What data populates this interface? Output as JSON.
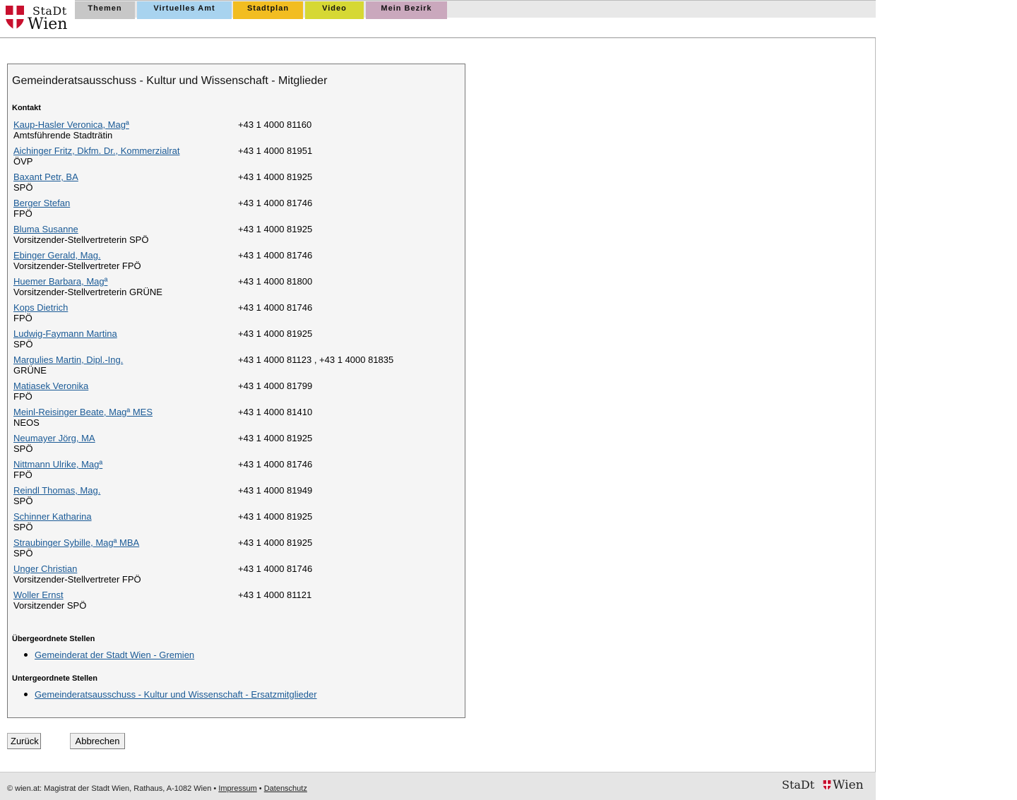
{
  "header": {
    "logo_line1": "StaDt",
    "logo_line2": "Wien",
    "nav": [
      {
        "label": "Themen",
        "color": "#c7c7c7"
      },
      {
        "label": "Virtuelles Amt",
        "color": "#a8d3ef"
      },
      {
        "label": "Stadtplan",
        "color": "#f2bd21"
      },
      {
        "label": "Video",
        "color": "#d6d834"
      },
      {
        "label": "Mein Bezirk",
        "color": "#caa8bd"
      }
    ]
  },
  "main": {
    "title": "Gemeinderatsausschuss - Kultur und Wissenschaft - Mitglieder",
    "contact_heading": "Kontakt",
    "members": [
      {
        "name": "Kaup-Hasler Veronica, Magª",
        "role": "Amtsführende Stadträtin",
        "phone": "+43 1 4000 81160"
      },
      {
        "name": "Aichinger Fritz, Dkfm. Dr., Kommerzialrat",
        "role": "ÖVP",
        "phone": "+43 1 4000 81951"
      },
      {
        "name": "Baxant Petr, BA",
        "role": "SPÖ",
        "phone": "+43 1 4000 81925"
      },
      {
        "name": "Berger Stefan",
        "role": "FPÖ",
        "phone": "+43 1 4000 81746"
      },
      {
        "name": "Bluma Susanne",
        "role": "Vorsitzender-Stellvertreterin SPÖ",
        "phone": "+43 1 4000 81925"
      },
      {
        "name": "Ebinger Gerald, Mag.",
        "role": "Vorsitzender-Stellvertreter FPÖ",
        "phone": "+43 1 4000 81746"
      },
      {
        "name": "Huemer Barbara, Magª",
        "role": "Vorsitzender-Stellvertreterin GRÜNE",
        "phone": "+43 1 4000 81800"
      },
      {
        "name": "Kops Dietrich",
        "role": "FPÖ",
        "phone": "+43 1 4000 81746"
      },
      {
        "name": "Ludwig-Faymann Martina",
        "role": "SPÖ",
        "phone": "+43 1 4000 81925"
      },
      {
        "name": "Margulies Martin, Dipl.-Ing.",
        "role": "GRÜNE",
        "phone": "+43 1 4000 81123 , +43 1 4000 81835"
      },
      {
        "name": "Matiasek Veronika",
        "role": "FPÖ",
        "phone": "+43 1 4000 81799"
      },
      {
        "name": "Meinl-Reisinger Beate, Magª MES",
        "role": "NEOS",
        "phone": "+43 1 4000 81410"
      },
      {
        "name": "Neumayer Jörg, MA",
        "role": "SPÖ",
        "phone": "+43 1 4000 81925"
      },
      {
        "name": "Nittmann Ulrike, Magª",
        "role": "FPÖ",
        "phone": "+43 1 4000 81746"
      },
      {
        "name": "Reindl Thomas, Mag.",
        "role": "SPÖ",
        "phone": "+43 1 4000 81949"
      },
      {
        "name": "Schinner Katharina",
        "role": "SPÖ",
        "phone": "+43 1 4000 81925"
      },
      {
        "name": "Straubinger Sybille, Magª MBA",
        "role": "SPÖ",
        "phone": "+43 1 4000 81925"
      },
      {
        "name": "Unger Christian",
        "role": "Vorsitzender-Stellvertreter FPÖ",
        "phone": "+43 1 4000 81746"
      },
      {
        "name": "Woller Ernst",
        "role": "Vorsitzender SPÖ",
        "phone": "+43 1 4000 81121"
      }
    ],
    "parent_heading": "Übergeordnete Stellen",
    "parent_link": "Gemeinderat der Stadt Wien - Gremien",
    "child_heading": "Untergeordnete Stellen",
    "child_link": "Gemeinderatsausschuss - Kultur und Wissenschaft - Ersatzmitglieder"
  },
  "buttons": {
    "back": "Zurück",
    "cancel": "Abbrechen"
  },
  "footer": {
    "text": "© wien.at: Magistrat der Stadt Wien, Rathaus, A-1082 Wien • ",
    "impressum": "Impressum",
    "separator": " • ",
    "datenschutz": "Datenschutz",
    "logo_stadt": "StaDt",
    "logo_wien": "Wien"
  }
}
